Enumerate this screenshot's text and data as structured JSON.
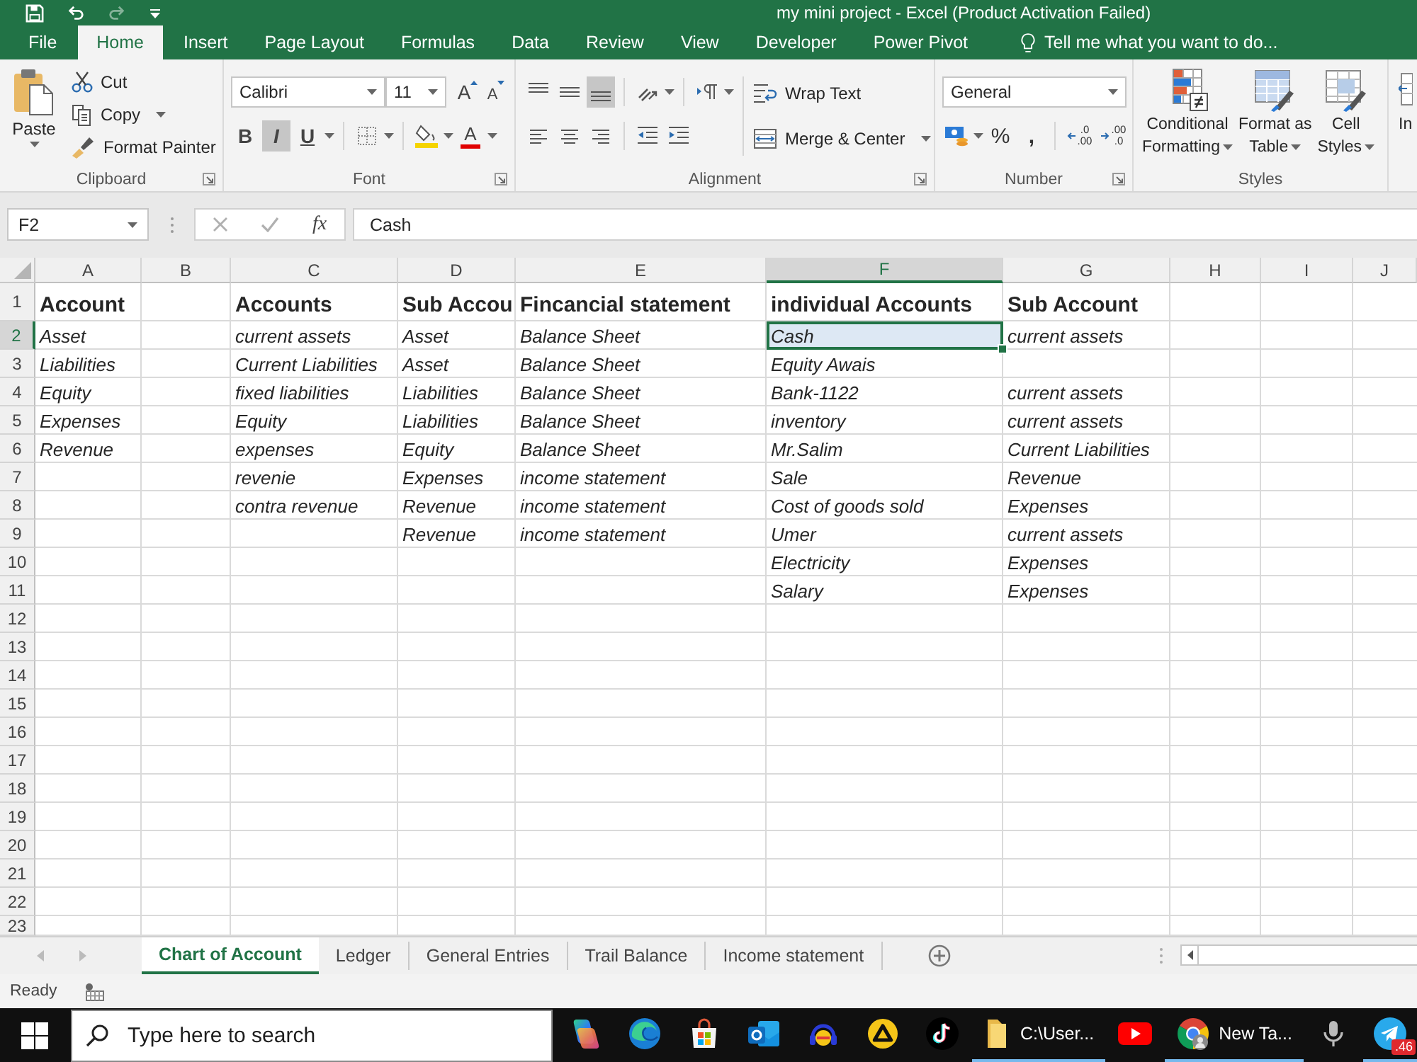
{
  "window": {
    "title": "my mini project - Excel (Product Activation Failed)"
  },
  "quick_access": [
    {
      "kind": "save",
      "disabled": false
    },
    {
      "kind": "undo",
      "disabled": false
    },
    {
      "kind": "redo",
      "disabled": true
    },
    {
      "kind": "customize",
      "disabled": false
    }
  ],
  "menu_tabs": [
    {
      "label": "File",
      "selected": false
    },
    {
      "label": "Home",
      "selected": true
    },
    {
      "label": "Insert",
      "selected": false
    },
    {
      "label": "Page Layout",
      "selected": false
    },
    {
      "label": "Formulas",
      "selected": false
    },
    {
      "label": "Data",
      "selected": false
    },
    {
      "label": "Review",
      "selected": false
    },
    {
      "label": "View",
      "selected": false
    },
    {
      "label": "Developer",
      "selected": false
    },
    {
      "label": "Power Pivot",
      "selected": false
    }
  ],
  "tell_me": {
    "placeholder": "Tell me what you want to do..."
  },
  "ribbon": {
    "clipboard": {
      "paste": "Paste",
      "cut": "Cut",
      "copy": "Copy",
      "format_painter": "Format Painter",
      "label": "Clipboard"
    },
    "font": {
      "name": "Calibri",
      "size": "11",
      "grow": "A",
      "shrink": "A",
      "styles": [
        {
          "kind": "bold",
          "label": "B",
          "selected": false
        },
        {
          "kind": "italic",
          "label": "I",
          "selected": true
        },
        {
          "kind": "underline",
          "label": "U",
          "selected": false
        }
      ],
      "text_tint": "A",
      "label": "Font"
    },
    "alignment": {
      "vertical": [
        {
          "kind": "top",
          "selected": false
        },
        {
          "kind": "middle",
          "selected": false
        },
        {
          "kind": "bottom",
          "selected": true
        }
      ],
      "horizontal": [
        {
          "kind": "left",
          "selected": false
        },
        {
          "kind": "center",
          "selected": false
        },
        {
          "kind": "right",
          "selected": false
        }
      ],
      "wrap_text": "Wrap Text",
      "merge": "Merge & Center",
      "label": "Alignment"
    },
    "number": {
      "format": "General",
      "percent": "%",
      "comma": ",",
      "increase_decimal": [
        ".0",
        ".00"
      ],
      "decrease_decimal": [
        ".00",
        ".0"
      ],
      "label": "Number"
    },
    "styles": {
      "buttons": [
        {
          "kind": "conditional",
          "lines": [
            "Conditional",
            "Formatting"
          ]
        },
        {
          "kind": "table",
          "lines": [
            "Format as",
            "Table"
          ]
        },
        {
          "kind": "cell",
          "lines": [
            "Cell",
            "Styles"
          ]
        }
      ],
      "label": "Styles"
    },
    "cells": {
      "insert": "In"
    }
  },
  "formula_bar": {
    "name_box": "F2",
    "function": "fx",
    "value": "Cash"
  },
  "sheet": {
    "columns": [
      {
        "label": "A",
        "selected": false
      },
      {
        "label": "B",
        "selected": false
      },
      {
        "label": "C",
        "selected": false
      },
      {
        "label": "D",
        "selected": false
      },
      {
        "label": "E",
        "selected": false
      },
      {
        "label": "F",
        "selected": true
      },
      {
        "label": "G",
        "selected": false
      },
      {
        "label": "H",
        "selected": false
      },
      {
        "label": "I",
        "selected": false
      },
      {
        "label": "J",
        "selected": false
      }
    ],
    "rows": [
      {
        "number": "1",
        "selected": false,
        "kind": "heading",
        "cells": [
          "Account",
          null,
          "Accounts",
          "Sub Accou",
          "Fincancial statement",
          "individual Accounts",
          "Sub Account"
        ]
      },
      {
        "number": "2",
        "selected": true,
        "kind": "entry",
        "cells": [
          "Asset",
          null,
          "current assets",
          "Asset",
          "Balance Sheet",
          "Cash",
          "current assets"
        ]
      },
      {
        "number": "3",
        "selected": false,
        "kind": "entry",
        "cells": [
          "Liabilities",
          null,
          "Current Liabilities",
          "Asset",
          "Balance Sheet",
          "Equity Awais",
          null
        ]
      },
      {
        "number": "4",
        "selected": false,
        "kind": "entry",
        "cells": [
          "Equity",
          null,
          "fixed liabilities",
          "Liabilities",
          "Balance Sheet",
          "Bank-1122",
          "current assets"
        ]
      },
      {
        "number": "5",
        "selected": false,
        "kind": "entry",
        "cells": [
          "Expenses",
          null,
          "Equity",
          "Liabilities",
          "Balance Sheet",
          "inventory",
          "current assets"
        ]
      },
      {
        "number": "6",
        "selected": false,
        "kind": "entry",
        "cells": [
          "Revenue",
          null,
          "expenses",
          "Equity",
          "Balance Sheet",
          "Mr.Salim",
          "Current Liabilities"
        ]
      },
      {
        "number": "7",
        "selected": false,
        "kind": "entry",
        "cells": [
          null,
          null,
          "revenie",
          "Expenses",
          "income statement",
          "Sale",
          "Revenue"
        ]
      },
      {
        "number": "8",
        "selected": false,
        "kind": "entry",
        "cells": [
          null,
          null,
          "contra revenue",
          "Revenue",
          "income statement",
          "Cost of goods sold",
          "Expenses"
        ]
      },
      {
        "number": "9",
        "selected": false,
        "kind": "entry",
        "cells": [
          null,
          null,
          null,
          "Revenue",
          "income statement",
          "Umer",
          "current assets"
        ]
      },
      {
        "number": "10",
        "selected": false,
        "kind": "entry",
        "cells": [
          null,
          null,
          null,
          null,
          null,
          "Electricity",
          "Expenses"
        ]
      },
      {
        "number": "11",
        "selected": false,
        "kind": "entry",
        "cells": [
          null,
          null,
          null,
          null,
          null,
          "Salary",
          "Expenses"
        ]
      },
      {
        "number": "12",
        "selected": false
      },
      {
        "number": "13",
        "selected": false
      },
      {
        "number": "14",
        "selected": false
      },
      {
        "number": "15",
        "selected": false
      },
      {
        "number": "16",
        "selected": false
      },
      {
        "number": "17",
        "selected": false
      },
      {
        "number": "18",
        "selected": false
      },
      {
        "number": "19",
        "selected": false
      },
      {
        "number": "20",
        "selected": false
      },
      {
        "number": "21",
        "selected": false
      },
      {
        "number": "22",
        "selected": false
      },
      {
        "number": "23",
        "selected": false
      }
    ]
  },
  "sheet_tabs": [
    {
      "label": "Chart of Account",
      "selected": true
    },
    {
      "label": "Ledger",
      "selected": false
    },
    {
      "label": "General Entries",
      "selected": false
    },
    {
      "label": "Trail Balance",
      "selected": false
    },
    {
      "label": "Income statement",
      "selected": false
    }
  ],
  "status_bar": {
    "text": "Ready"
  },
  "taskbar": {
    "search": {
      "placeholder": "Type here to search"
    },
    "apps": [
      {
        "kind": "petals",
        "running": false
      },
      {
        "kind": "swirl",
        "running": false
      },
      {
        "kind": "bag",
        "running": false
      },
      {
        "kind": "mail",
        "running": false
      },
      {
        "kind": "headphones",
        "running": false
      },
      {
        "kind": "triangle",
        "running": false
      },
      {
        "kind": "note",
        "running": false
      },
      {
        "kind": "folder",
        "label": "C:\\User...",
        "running": true
      },
      {
        "kind": "play",
        "running": false
      },
      {
        "kind": "browser",
        "label": "New Ta...",
        "running": true
      },
      {
        "kind": "microphone",
        "running": false
      },
      {
        "kind": "plane",
        "badge": ".46",
        "running": true
      }
    ]
  }
}
